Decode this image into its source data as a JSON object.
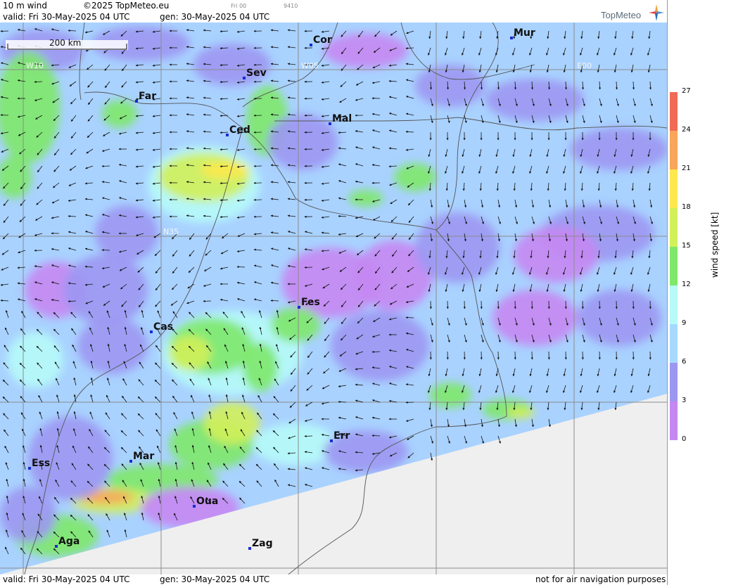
{
  "header": {
    "title": "10 m wind",
    "copyright": "©2025 TopMeteo.eu",
    "valid_label": "valid:  Fri  30-May-2025  04 UTC",
    "gen_label": "gen: 30-May-2025 04 UTC",
    "small_time": "Fri 00",
    "small_code": "9410"
  },
  "logo": {
    "text": "TopMeteo"
  },
  "map": {
    "scale_label": "200 km",
    "grid_labels": {
      "w10": "W10",
      "w05": "W05",
      "e00": "E00",
      "n35": "N35"
    },
    "cities": [
      {
        "code": "Cor"
      },
      {
        "code": "Mur"
      },
      {
        "code": "Sev"
      },
      {
        "code": "Far"
      },
      {
        "code": "Ced"
      },
      {
        "code": "Mal"
      },
      {
        "code": "Fes"
      },
      {
        "code": "Cas"
      },
      {
        "code": "Err"
      },
      {
        "code": "Ess"
      },
      {
        "code": "Mar"
      },
      {
        "code": "Oua"
      },
      {
        "code": "Aga"
      },
      {
        "code": "Zag"
      }
    ]
  },
  "footer": {
    "valid_label": "valid:  Fri  30-May-2025  04 UTC",
    "gen_label": "gen: 30-May-2025 04 UTC",
    "disclaimer": "not for air navigation purposes"
  },
  "legend": {
    "unit_label": "wind speed [kt]",
    "ticks": [
      "27",
      "24",
      "21",
      "18",
      "15",
      "12",
      "9",
      "6",
      "3",
      "0"
    ],
    "colors": [
      "#f06a55",
      "#f7a65a",
      "#fde84d",
      "#d2f059",
      "#7ee86a",
      "#b6fbf8",
      "#a7d9ff",
      "#9c97f2",
      "#c587f2"
    ]
  }
}
